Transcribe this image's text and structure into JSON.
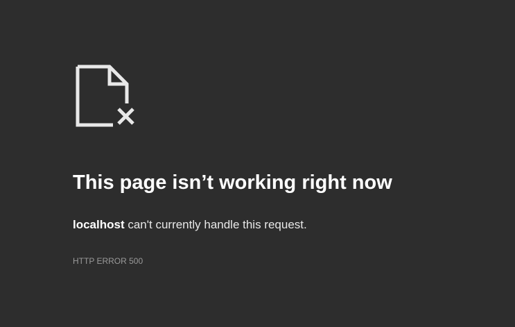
{
  "icon": "broken-page-icon",
  "heading": "This page isn’t working right now",
  "message": {
    "host": "localhost",
    "text": " can't currently handle this request."
  },
  "error_code": "HTTP ERROR 500",
  "colors": {
    "background": "#2d2d2d",
    "text": "#ffffff",
    "muted": "#9a9a9a"
  }
}
